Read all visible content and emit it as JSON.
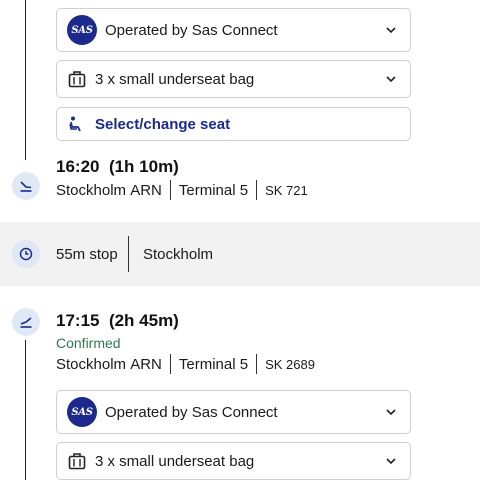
{
  "segment1": {
    "operator": {
      "label": "Operated by Sas Connect",
      "logo_text": "SAS"
    },
    "baggage": {
      "label": "3 x small underseat bag"
    },
    "seat": {
      "label": "Select/change seat"
    }
  },
  "arrival": {
    "time": "16:20",
    "duration": "(1h 10m)",
    "city": "Stockholm",
    "airport": "ARN",
    "terminal_label": "Terminal",
    "terminal": "5",
    "flight": "SK 721"
  },
  "stop": {
    "duration": "55m stop",
    "city": "Stockholm"
  },
  "departure": {
    "time": "17:15",
    "duration": "(2h 45m)",
    "status": "Confirmed",
    "city": "Stockholm",
    "airport": "ARN",
    "terminal_label": "Terminal",
    "terminal": "5",
    "flight": "SK 2689"
  },
  "segment2": {
    "operator": {
      "label": "Operated by Sas Connect",
      "logo_text": "SAS"
    },
    "baggage": {
      "label": "3 x small underseat bag"
    }
  },
  "colors": {
    "brand": "#1b2a8c",
    "confirmed": "#2f7a4d",
    "node_bg": "#dfe9f6",
    "stop_bg": "#f2f2f2"
  }
}
